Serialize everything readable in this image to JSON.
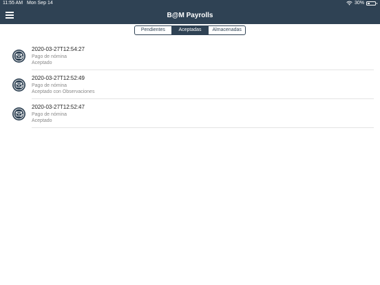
{
  "status_bar": {
    "time": "11:55 AM",
    "date": "Mon Sep 14",
    "battery": "30%"
  },
  "header": {
    "title": "B@M Payrolls",
    "menu_icon": "hamburger-icon"
  },
  "tabs": [
    {
      "label": "Pendientes",
      "active": false
    },
    {
      "label": "Aceptadas",
      "active": true
    },
    {
      "label": "Almacenadas",
      "active": false
    }
  ],
  "items": [
    {
      "date": "2020-03-27T12:54:27",
      "type": "Pago de nómina",
      "status": "Aceptado",
      "icon": "envelope-check-icon"
    },
    {
      "date": "2020-03-27T12:52:49",
      "type": "Pago de nómina",
      "status": "Aceptado con Observaciones",
      "icon": "envelope-check-icon"
    },
    {
      "date": "2020-03-27T12:52:47",
      "type": "Pago de nómina",
      "status": "Aceptado",
      "icon": "envelope-check-icon"
    }
  ],
  "colors": {
    "header_bg": "#2f4254",
    "accent": "#2f4254",
    "separator": "#e3e3e3"
  }
}
